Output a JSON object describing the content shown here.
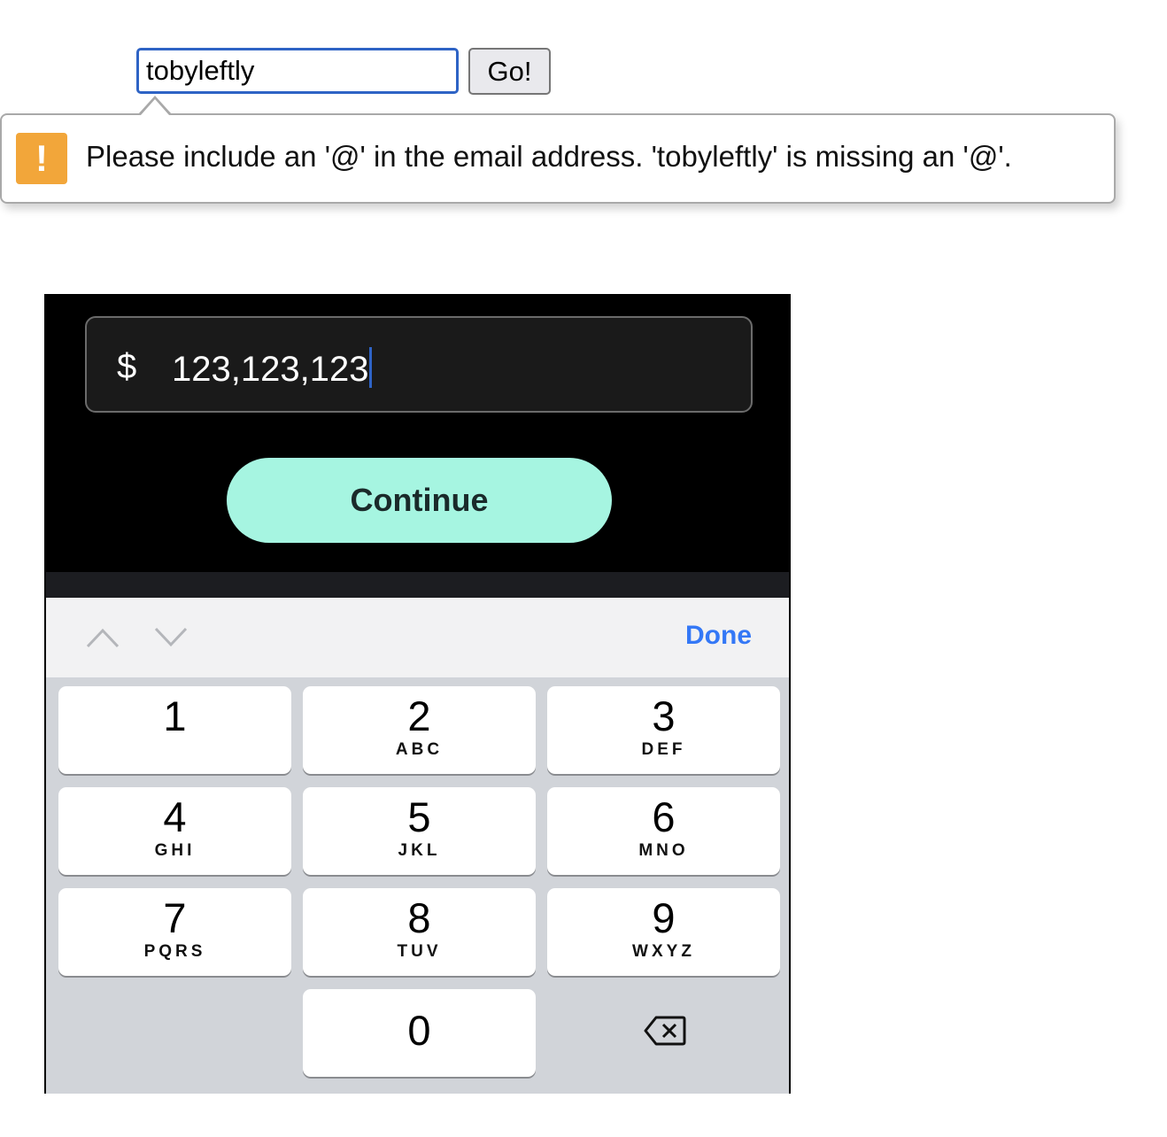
{
  "form": {
    "email_value": "tobyleftly",
    "go_label": "Go!",
    "validation_message": "Please include an '@' in the email address. 'tobyleftly' is missing an '@'.",
    "warning_glyph": "!"
  },
  "phone": {
    "currency_symbol": "$",
    "amount": "123,123,123",
    "continue_label": "Continue",
    "toolbar": {
      "prev_icon": "chevron-up-icon",
      "next_icon": "chevron-down-icon",
      "done_label": "Done"
    },
    "keys": [
      {
        "num": "1",
        "letters": ""
      },
      {
        "num": "2",
        "letters": "ABC"
      },
      {
        "num": "3",
        "letters": "DEF"
      },
      {
        "num": "4",
        "letters": "GHI"
      },
      {
        "num": "5",
        "letters": "JKL"
      },
      {
        "num": "6",
        "letters": "MNO"
      },
      {
        "num": "7",
        "letters": "PQRS"
      },
      {
        "num": "8",
        "letters": "TUV"
      },
      {
        "num": "9",
        "letters": "WXYZ"
      },
      {
        "num": "0",
        "letters": ""
      }
    ],
    "colors": {
      "accent_button": "#a6f5e1",
      "done_blue": "#3478f6",
      "warning_orange": "#f2a63a",
      "focus_blue": "#2e63c5"
    }
  }
}
